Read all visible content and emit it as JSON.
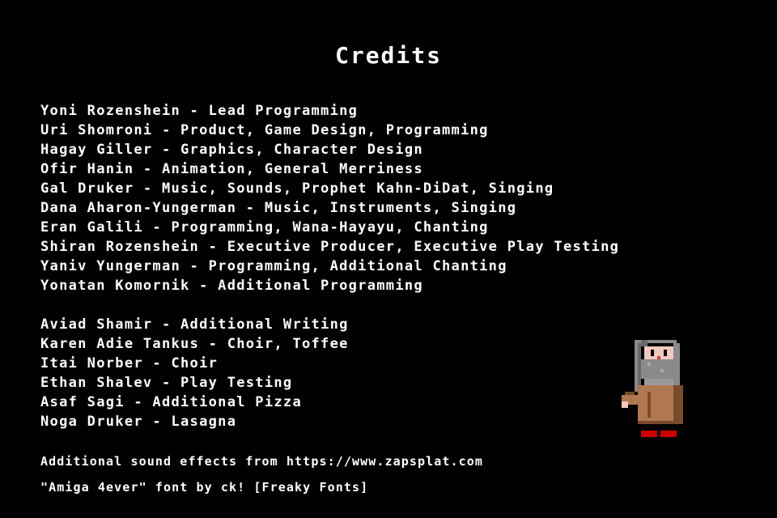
{
  "screen": {
    "title": "Credits"
  },
  "credits_main": [
    "Yoni Rozenshein - Lead Programming",
    "Uri Shomroni - Product, Game Design, Programming",
    "Hagay Giller - Graphics, Character Design",
    "Ofir Hanin - Animation, General Merriness",
    "Gal Druker - Music, Sounds, Prophet Kahn-DiDat, Singing",
    "Dana Aharon-Yungerman - Music, Instruments, Singing",
    "Eran Galili - Programming, Wana-Hayayu, Chanting",
    "Shiran Rozenshein - Executive Producer, Executive Play Testing",
    "Yaniv Yungerman - Programming, Additional Chanting",
    "Yonatan Komornik - Additional Programming"
  ],
  "credits_additional": [
    "Aviad Shamir - Additional Writing",
    "Karen Adie Tankus - Choir, Toffee",
    "Itai Norber - Choir",
    "Ethan Shalev - Play Testing",
    "Asaf Sagi - Additional Pizza",
    "Noga Druker - Lasagna"
  ],
  "footer": {
    "sound_effects": "Additional sound effects from https://www.zapsplat.com",
    "font_credit": "\"Amiga 4ever\" font by ck! [Freaky Fonts]"
  },
  "colors": {
    "background": "#000000",
    "text": "#ffffff",
    "robe": "#b07850",
    "robe_shadow": "#7a4a2a",
    "hair": "#8a8a8a",
    "skin": "#f0c8c0",
    "shoes": "#cc0000"
  },
  "character": {
    "icon": "prophet-character-sprite"
  }
}
